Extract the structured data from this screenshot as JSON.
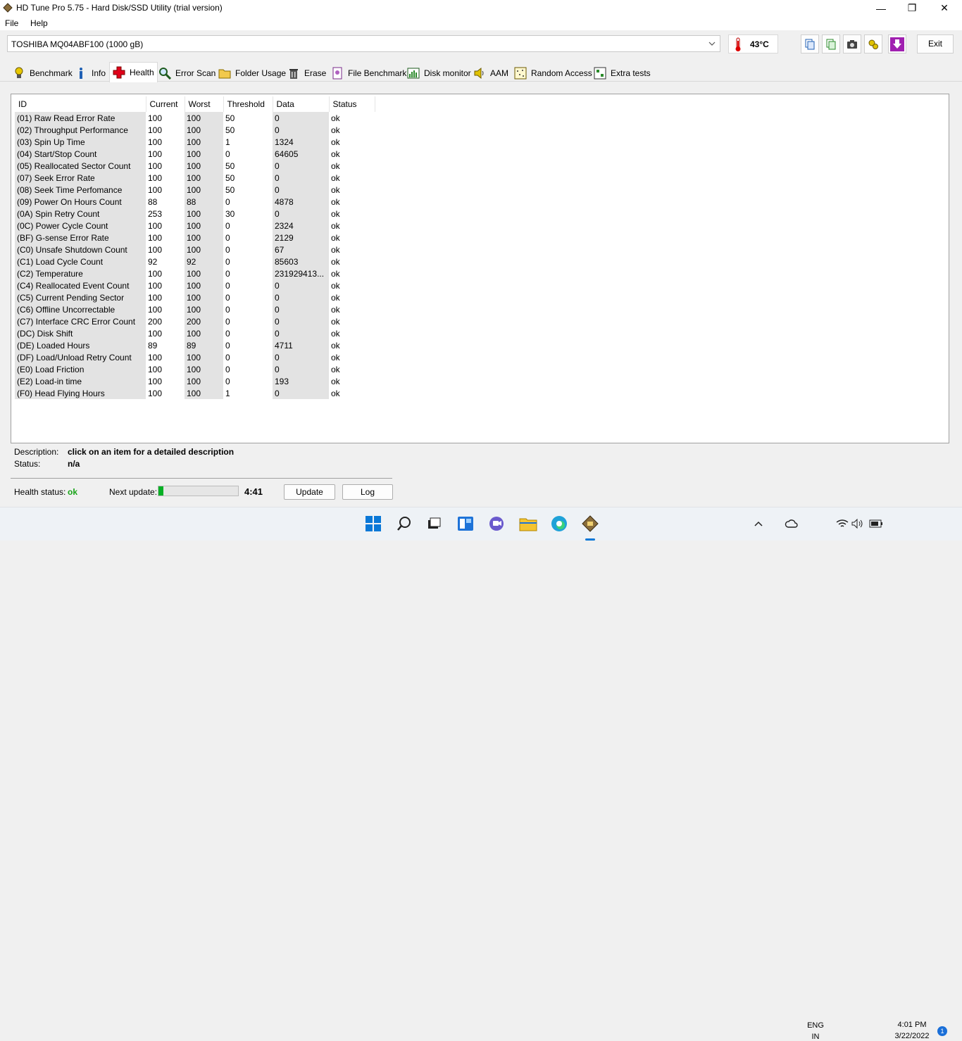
{
  "window": {
    "title": "HD Tune Pro 5.75 - Hard Disk/SSD Utility (trial version)"
  },
  "menu": {
    "file": "File",
    "help": "Help"
  },
  "drive": {
    "selected": "TOSHIBA MQ04ABF100 (1000 gB)",
    "temperature": "43°C"
  },
  "toolbar": {
    "exit_label": "Exit"
  },
  "tabs": [
    {
      "label": "Benchmark",
      "icon": "bulb-icon"
    },
    {
      "label": "Info",
      "icon": "info-icon"
    },
    {
      "label": "Health",
      "icon": "health-cross-icon",
      "active": true
    },
    {
      "label": "Error Scan",
      "icon": "magnifier-icon"
    },
    {
      "label": "Folder Usage",
      "icon": "folder-icon"
    },
    {
      "label": "Erase",
      "icon": "trash-icon"
    },
    {
      "label": "File Benchmark",
      "icon": "file-bench-icon"
    },
    {
      "label": "Disk monitor",
      "icon": "disk-monitor-icon"
    },
    {
      "label": "AAM",
      "icon": "speaker-icon"
    },
    {
      "label": "Random Access",
      "icon": "random-access-icon"
    },
    {
      "label": "Extra tests",
      "icon": "extra-tests-icon"
    }
  ],
  "table": {
    "headers": [
      "ID",
      "Current",
      "Worst",
      "Threshold",
      "Data",
      "Status"
    ],
    "rows": [
      [
        "(01) Raw Read Error Rate",
        "100",
        "100",
        "50",
        "0",
        "ok"
      ],
      [
        "(02) Throughput Performance",
        "100",
        "100",
        "50",
        "0",
        "ok"
      ],
      [
        "(03) Spin Up Time",
        "100",
        "100",
        "1",
        "1324",
        "ok"
      ],
      [
        "(04) Start/Stop Count",
        "100",
        "100",
        "0",
        "64605",
        "ok"
      ],
      [
        "(05) Reallocated Sector Count",
        "100",
        "100",
        "50",
        "0",
        "ok"
      ],
      [
        "(07) Seek Error Rate",
        "100",
        "100",
        "50",
        "0",
        "ok"
      ],
      [
        "(08) Seek Time Perfomance",
        "100",
        "100",
        "50",
        "0",
        "ok"
      ],
      [
        "(09) Power On Hours Count",
        "88",
        "88",
        "0",
        "4878",
        "ok"
      ],
      [
        "(0A) Spin Retry Count",
        "253",
        "100",
        "30",
        "0",
        "ok"
      ],
      [
        "(0C) Power Cycle Count",
        "100",
        "100",
        "0",
        "2324",
        "ok"
      ],
      [
        "(BF) G-sense Error Rate",
        "100",
        "100",
        "0",
        "2129",
        "ok"
      ],
      [
        "(C0) Unsafe Shutdown Count",
        "100",
        "100",
        "0",
        "67",
        "ok"
      ],
      [
        "(C1) Load Cycle Count",
        "92",
        "92",
        "0",
        "85603",
        "ok"
      ],
      [
        "(C2) Temperature",
        "100",
        "100",
        "0",
        "231929413...",
        "ok"
      ],
      [
        "(C4) Reallocated Event Count",
        "100",
        "100",
        "0",
        "0",
        "ok"
      ],
      [
        "(C5) Current Pending Sector",
        "100",
        "100",
        "0",
        "0",
        "ok"
      ],
      [
        "(C6) Offline Uncorrectable",
        "100",
        "100",
        "0",
        "0",
        "ok"
      ],
      [
        "(C7) Interface CRC Error Count",
        "200",
        "200",
        "0",
        "0",
        "ok"
      ],
      [
        "(DC) Disk Shift",
        "100",
        "100",
        "0",
        "0",
        "ok"
      ],
      [
        "(DE) Loaded Hours",
        "89",
        "89",
        "0",
        "4711",
        "ok"
      ],
      [
        "(DF) Load/Unload Retry Count",
        "100",
        "100",
        "0",
        "0",
        "ok"
      ],
      [
        "(E0) Load Friction",
        "100",
        "100",
        "0",
        "0",
        "ok"
      ],
      [
        "(E2) Load-in time",
        "100",
        "100",
        "0",
        "193",
        "ok"
      ],
      [
        "(F0) Head Flying Hours",
        "100",
        "100",
        "1",
        "0",
        "ok"
      ]
    ]
  },
  "details": {
    "description_label": "Description:",
    "description_value": "click on an item for a detailed description",
    "status_label": "Status:",
    "status_value": "n/a"
  },
  "health": {
    "status_label": "Health status:",
    "status_value": "ok",
    "next_update_label": "Next update:",
    "next_update_progress": 0.06,
    "countdown": "4:41",
    "update_button": "Update",
    "log_button": "Log",
    "status_color": "#17a317",
    "progress_color": "#06b025"
  },
  "tray": {
    "lang1": "ENG",
    "lang2": "IN",
    "time": "4:01 PM",
    "date": "3/22/2022",
    "notifications": "1"
  }
}
